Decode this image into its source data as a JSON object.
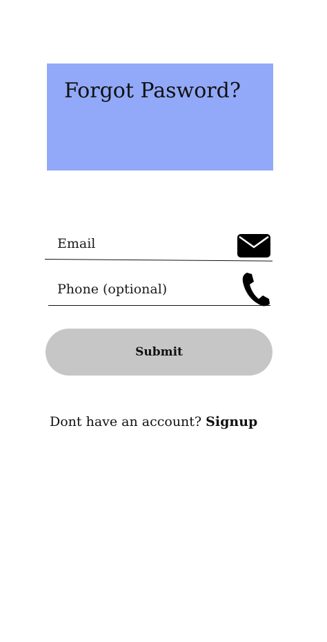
{
  "header": {
    "title": "Forgot Pasword?",
    "background_color": "#91a9f8"
  },
  "form": {
    "email_label": "Email",
    "email_icon": "mail-icon",
    "phone_label": "Phone (optional)",
    "phone_icon": "phone-icon",
    "submit_label": "Submit",
    "submit_color": "#c6c6c6"
  },
  "footer": {
    "prompt": "Dont have an account?",
    "signup_label": "Signup"
  }
}
